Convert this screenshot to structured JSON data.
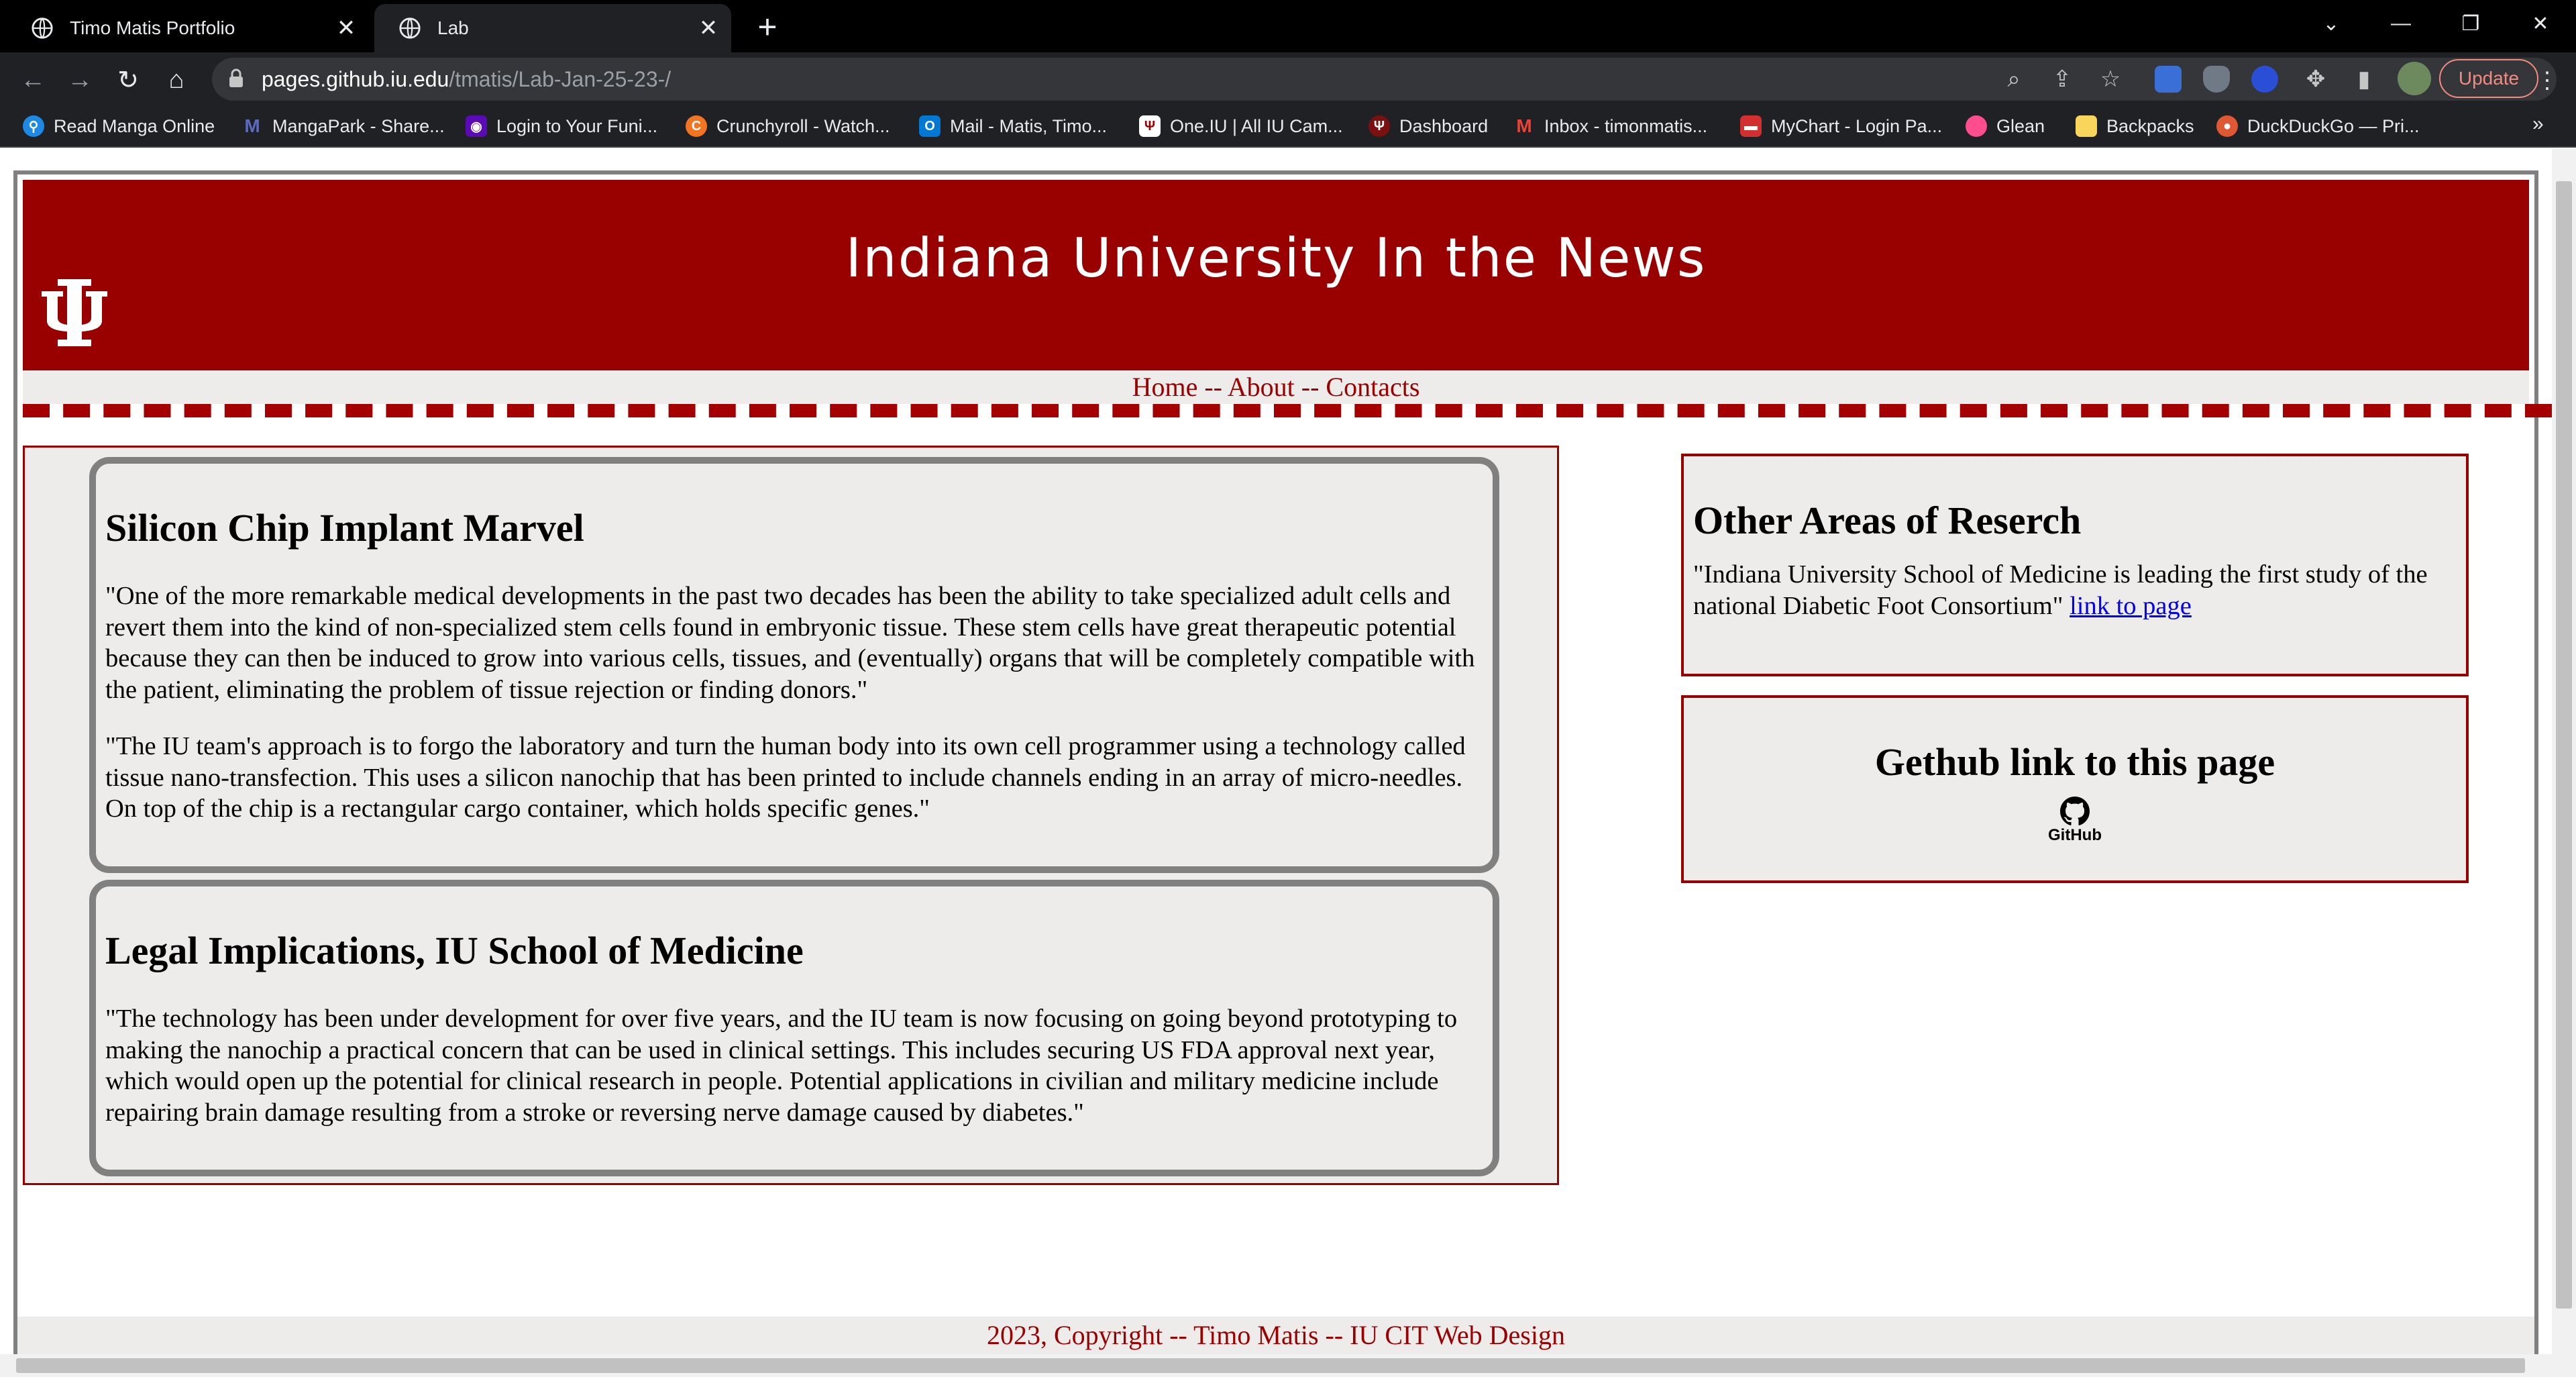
{
  "browser": {
    "tabs": [
      {
        "title": "Timo Matis Portfolio",
        "active": false
      },
      {
        "title": "Lab",
        "active": true
      }
    ],
    "close_glyph": "✕",
    "new_tab_glyph": "+",
    "window_controls": {
      "tab_search": "⌄",
      "minimize": "—",
      "restore": "❐",
      "close": "✕"
    },
    "address": {
      "host": "pages.github.iu.edu",
      "path": "/tmatis/Lab-Jan-25-23-/"
    },
    "update_label": "Update",
    "bookmarks": [
      {
        "label": "Read Manga Online",
        "icon": "manga-icon",
        "color": "#1e88e5"
      },
      {
        "label": "MangaPark - Share...",
        "icon": "mangapark-icon",
        "color": "#3949ab"
      },
      {
        "label": "Login to Your Funi...",
        "icon": "funimation-icon",
        "color": "#5b0bb5"
      },
      {
        "label": "Crunchyroll - Watch...",
        "icon": "crunchyroll-icon",
        "color": "#f47521"
      },
      {
        "label": "Mail - Matis, Timo...",
        "icon": "outlook-icon",
        "color": "#0078d4"
      },
      {
        "label": "One.IU | All IU Cam...",
        "icon": "iu-icon",
        "color": "#990000"
      },
      {
        "label": "Dashboard",
        "icon": "dashboard-icon",
        "color": "#7a1010"
      },
      {
        "label": "Inbox - timonmatis...",
        "icon": "gmail-icon",
        "color": "#ea4335"
      },
      {
        "label": "MyChart - Login Pa...",
        "icon": "mychart-icon",
        "color": "#d32f2f"
      },
      {
        "label": "Glean",
        "icon": "glean-icon",
        "color": "#ff4d8d"
      },
      {
        "label": "Backpacks",
        "icon": "folder-icon",
        "color": "#f9d55c"
      },
      {
        "label": "DuckDuckGo — Pri...",
        "icon": "duckduckgo-icon",
        "color": "#de5833"
      }
    ],
    "bookmarks_more": "»"
  },
  "page": {
    "header_title": "Indiana University In the News",
    "nav": "Home -- About -- Contacts",
    "articles": [
      {
        "title": "Silicon Chip Implant Marvel",
        "paragraphs": [
          "\"One of the more remarkable medical developments in the past two decades has been the ability to take specialized adult cells and revert them into the kind of non-specialized stem cells found in embryonic tissue. These stem cells have great therapeutic potential because they can then be induced to grow into various cells, tissues, and (eventually) organs that will be completely compatible with the patient, eliminating the problem of tissue rejection or finding donors.\"",
          "\"The IU team's approach is to forgo the laboratory and turn the human body into its own cell programmer using a technology called tissue nano-transfection. This uses a silicon nanochip that has been printed to include channels ending in an array of micro-needles. On top of the chip is a rectangular cargo container, which holds specific genes.\""
        ]
      },
      {
        "title": "Legal Implications, IU School of Medicine",
        "paragraphs": [
          "\"The technology has been under development for over five years, and the IU team is now focusing on going beyond prototyping to making the nanochip a practical concern that can be used in clinical settings. This includes securing US FDA approval next year, which would open up the potential for clinical research in people. Potential applications in civilian and military medicine include repairing brain damage resulting from a stroke or reversing nerve damage caused by diabetes.\""
        ]
      }
    ],
    "sidebar": {
      "research_title": "Other Areas of Reserch",
      "research_text": "\"Indiana University School of Medicine is leading the first study of the national Diabetic Foot Consortium\"",
      "research_link": "link to page",
      "github_title": "Gethub link to this page",
      "github_logo_text": "GitHub"
    },
    "footer": "2023, Copyright -- Timo Matis -- IU CIT Web Design"
  },
  "colors": {
    "iu_crimson": "#990000",
    "panel_bg": "#eeebeb",
    "article_border": "#808080",
    "link": "#0000ee"
  }
}
